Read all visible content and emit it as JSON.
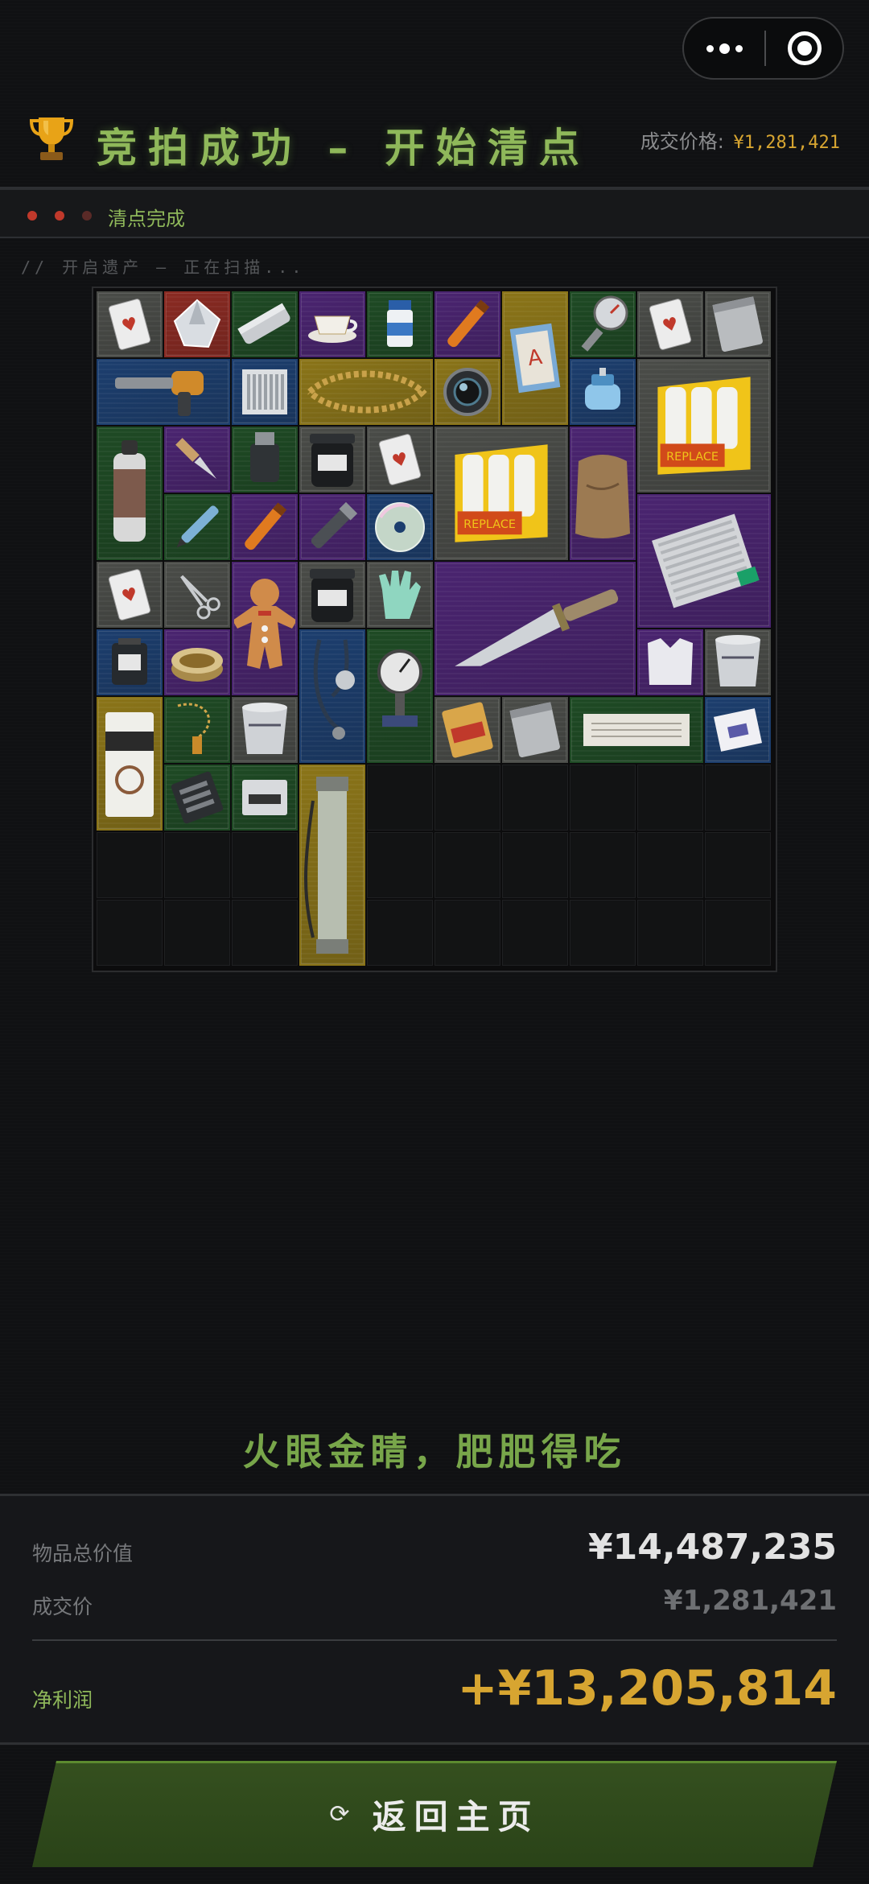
{
  "header": {
    "title": "竞拍成功 – 开始清点",
    "price_label": "成交价格:",
    "price_value": "¥1,281,421"
  },
  "status": {
    "text": "清点完成",
    "dots": [
      "#c0392b",
      "#c0392b",
      "#5a2a27"
    ]
  },
  "scan_text": "// 开启遗产 – 正在扫描...",
  "grid": {
    "columns": 10,
    "rows": 10,
    "rarity_colors": {
      "gray": "#4a4c48",
      "red": "#8a2a22",
      "green": "#1e4a24",
      "purple": "#4a2470",
      "blue": "#1c3e6e",
      "gold": "#8a7418"
    },
    "items": [
      {
        "name": "playing-card",
        "rarity": "gray",
        "icon": "card"
      },
      {
        "name": "diamond",
        "rarity": "red",
        "icon": "gem"
      },
      {
        "name": "silver-tube",
        "rarity": "green",
        "icon": "tube"
      },
      {
        "name": "teacup",
        "rarity": "purple",
        "icon": "cup"
      },
      {
        "name": "pill-bottle",
        "rarity": "green",
        "icon": "bottle"
      },
      {
        "name": "flare",
        "rarity": "purple",
        "icon": "stick"
      },
      {
        "name": "notebook",
        "rarity": "gold",
        "icon": "book"
      },
      {
        "name": "pressure-gauge",
        "rarity": "green",
        "icon": "gauge"
      },
      {
        "name": "playing-card",
        "rarity": "gray",
        "icon": "card"
      },
      {
        "name": "sealed-pouch",
        "rarity": "gray",
        "icon": "pouch"
      },
      {
        "name": "heat-gun",
        "rarity": "blue",
        "icon": "tool"
      },
      {
        "name": "filter-cartridge",
        "rarity": "blue",
        "icon": "box"
      },
      {
        "name": "gold-necklace",
        "rarity": "gold",
        "icon": "chain"
      },
      {
        "name": "camera-lens",
        "rarity": "gold",
        "icon": "lens"
      },
      {
        "name": "gas-canister",
        "rarity": "blue",
        "icon": "canister"
      },
      {
        "name": "candle-pack",
        "rarity": "gray",
        "icon": "candles"
      },
      {
        "name": "spray-can",
        "rarity": "green",
        "icon": "can"
      },
      {
        "name": "folding-knife",
        "rarity": "purple",
        "icon": "knife"
      },
      {
        "name": "lighter",
        "rarity": "green",
        "icon": "lighter"
      },
      {
        "name": "protein-jar",
        "rarity": "gray",
        "icon": "jar"
      },
      {
        "name": "playing-card",
        "rarity": "gray",
        "icon": "card"
      },
      {
        "name": "candle-pack",
        "rarity": "gray",
        "icon": "candles"
      },
      {
        "name": "burlap-sack",
        "rarity": "purple",
        "icon": "sack"
      },
      {
        "name": "pen",
        "rarity": "green",
        "icon": "pen"
      },
      {
        "name": "flare",
        "rarity": "purple",
        "icon": "stick"
      },
      {
        "name": "flashlight",
        "rarity": "purple",
        "icon": "torch"
      },
      {
        "name": "compact-disc",
        "rarity": "blue",
        "icon": "disc"
      },
      {
        "name": "graphics-card",
        "rarity": "purple",
        "icon": "gpu"
      },
      {
        "name": "playing-card",
        "rarity": "gray",
        "icon": "card"
      },
      {
        "name": "scissors",
        "rarity": "gray",
        "icon": "scissors"
      },
      {
        "name": "gingerbread-man",
        "rarity": "purple",
        "icon": "ginger"
      },
      {
        "name": "protein-jar",
        "rarity": "gray",
        "icon": "jar"
      },
      {
        "name": "rubber-glove",
        "rarity": "gray",
        "icon": "glove"
      },
      {
        "name": "combat-knife",
        "rarity": "purple",
        "icon": "bigknife"
      },
      {
        "name": "power-bank",
        "rarity": "blue",
        "icon": "battery"
      },
      {
        "name": "tin-can",
        "rarity": "purple",
        "icon": "tin"
      },
      {
        "name": "stethoscope",
        "rarity": "blue",
        "icon": "steth"
      },
      {
        "name": "pressure-valve",
        "rarity": "green",
        "icon": "valve"
      },
      {
        "name": "vest",
        "rarity": "purple",
        "icon": "vest"
      },
      {
        "name": "paint-bucket",
        "rarity": "gray",
        "icon": "bucket"
      },
      {
        "name": "coffee-bag",
        "rarity": "gold",
        "icon": "bag"
      },
      {
        "name": "necklace-pendant",
        "rarity": "green",
        "icon": "pendant"
      },
      {
        "name": "paint-bucket",
        "rarity": "gray",
        "icon": "bucket"
      },
      {
        "name": "snack-bag",
        "rarity": "gray",
        "icon": "snack"
      },
      {
        "name": "sealed-pouch",
        "rarity": "gray",
        "icon": "pouch"
      },
      {
        "name": "paper-scroll",
        "rarity": "green",
        "icon": "scroll"
      },
      {
        "name": "envelope",
        "rarity": "blue",
        "icon": "envelope"
      },
      {
        "name": "circuit-board",
        "rarity": "green",
        "icon": "board"
      },
      {
        "name": "ssd-drive",
        "rarity": "green",
        "icon": "drive"
      },
      {
        "name": "map-tube",
        "rarity": "gold",
        "icon": "maptube"
      }
    ]
  },
  "quote": "火眼金睛，肥肥得吃",
  "summary": {
    "total_label": "物品总价值",
    "total_value": "¥14,487,235",
    "deal_label": "成交价",
    "deal_value": "¥1,281,421",
    "profit_label": "净利润",
    "profit_value": "+¥13,205,814"
  },
  "button": {
    "icon": "refresh-icon",
    "label": "返回主页"
  }
}
